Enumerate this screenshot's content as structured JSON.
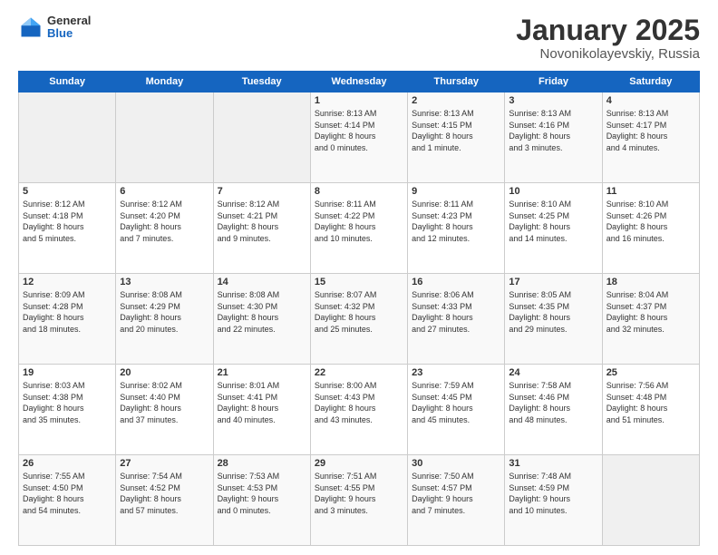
{
  "logo": {
    "general": "General",
    "blue": "Blue"
  },
  "header": {
    "title": "January 2025",
    "location": "Novonikolayevskiy, Russia"
  },
  "days_of_week": [
    "Sunday",
    "Monday",
    "Tuesday",
    "Wednesday",
    "Thursday",
    "Friday",
    "Saturday"
  ],
  "weeks": [
    [
      {
        "day": "",
        "info": ""
      },
      {
        "day": "",
        "info": ""
      },
      {
        "day": "",
        "info": ""
      },
      {
        "day": "1",
        "info": "Sunrise: 8:13 AM\nSunset: 4:14 PM\nDaylight: 8 hours\nand 0 minutes."
      },
      {
        "day": "2",
        "info": "Sunrise: 8:13 AM\nSunset: 4:15 PM\nDaylight: 8 hours\nand 1 minute."
      },
      {
        "day": "3",
        "info": "Sunrise: 8:13 AM\nSunset: 4:16 PM\nDaylight: 8 hours\nand 3 minutes."
      },
      {
        "day": "4",
        "info": "Sunrise: 8:13 AM\nSunset: 4:17 PM\nDaylight: 8 hours\nand 4 minutes."
      }
    ],
    [
      {
        "day": "5",
        "info": "Sunrise: 8:12 AM\nSunset: 4:18 PM\nDaylight: 8 hours\nand 5 minutes."
      },
      {
        "day": "6",
        "info": "Sunrise: 8:12 AM\nSunset: 4:20 PM\nDaylight: 8 hours\nand 7 minutes."
      },
      {
        "day": "7",
        "info": "Sunrise: 8:12 AM\nSunset: 4:21 PM\nDaylight: 8 hours\nand 9 minutes."
      },
      {
        "day": "8",
        "info": "Sunrise: 8:11 AM\nSunset: 4:22 PM\nDaylight: 8 hours\nand 10 minutes."
      },
      {
        "day": "9",
        "info": "Sunrise: 8:11 AM\nSunset: 4:23 PM\nDaylight: 8 hours\nand 12 minutes."
      },
      {
        "day": "10",
        "info": "Sunrise: 8:10 AM\nSunset: 4:25 PM\nDaylight: 8 hours\nand 14 minutes."
      },
      {
        "day": "11",
        "info": "Sunrise: 8:10 AM\nSunset: 4:26 PM\nDaylight: 8 hours\nand 16 minutes."
      }
    ],
    [
      {
        "day": "12",
        "info": "Sunrise: 8:09 AM\nSunset: 4:28 PM\nDaylight: 8 hours\nand 18 minutes."
      },
      {
        "day": "13",
        "info": "Sunrise: 8:08 AM\nSunset: 4:29 PM\nDaylight: 8 hours\nand 20 minutes."
      },
      {
        "day": "14",
        "info": "Sunrise: 8:08 AM\nSunset: 4:30 PM\nDaylight: 8 hours\nand 22 minutes."
      },
      {
        "day": "15",
        "info": "Sunrise: 8:07 AM\nSunset: 4:32 PM\nDaylight: 8 hours\nand 25 minutes."
      },
      {
        "day": "16",
        "info": "Sunrise: 8:06 AM\nSunset: 4:33 PM\nDaylight: 8 hours\nand 27 minutes."
      },
      {
        "day": "17",
        "info": "Sunrise: 8:05 AM\nSunset: 4:35 PM\nDaylight: 8 hours\nand 29 minutes."
      },
      {
        "day": "18",
        "info": "Sunrise: 8:04 AM\nSunset: 4:37 PM\nDaylight: 8 hours\nand 32 minutes."
      }
    ],
    [
      {
        "day": "19",
        "info": "Sunrise: 8:03 AM\nSunset: 4:38 PM\nDaylight: 8 hours\nand 35 minutes."
      },
      {
        "day": "20",
        "info": "Sunrise: 8:02 AM\nSunset: 4:40 PM\nDaylight: 8 hours\nand 37 minutes."
      },
      {
        "day": "21",
        "info": "Sunrise: 8:01 AM\nSunset: 4:41 PM\nDaylight: 8 hours\nand 40 minutes."
      },
      {
        "day": "22",
        "info": "Sunrise: 8:00 AM\nSunset: 4:43 PM\nDaylight: 8 hours\nand 43 minutes."
      },
      {
        "day": "23",
        "info": "Sunrise: 7:59 AM\nSunset: 4:45 PM\nDaylight: 8 hours\nand 45 minutes."
      },
      {
        "day": "24",
        "info": "Sunrise: 7:58 AM\nSunset: 4:46 PM\nDaylight: 8 hours\nand 48 minutes."
      },
      {
        "day": "25",
        "info": "Sunrise: 7:56 AM\nSunset: 4:48 PM\nDaylight: 8 hours\nand 51 minutes."
      }
    ],
    [
      {
        "day": "26",
        "info": "Sunrise: 7:55 AM\nSunset: 4:50 PM\nDaylight: 8 hours\nand 54 minutes."
      },
      {
        "day": "27",
        "info": "Sunrise: 7:54 AM\nSunset: 4:52 PM\nDaylight: 8 hours\nand 57 minutes."
      },
      {
        "day": "28",
        "info": "Sunrise: 7:53 AM\nSunset: 4:53 PM\nDaylight: 9 hours\nand 0 minutes."
      },
      {
        "day": "29",
        "info": "Sunrise: 7:51 AM\nSunset: 4:55 PM\nDaylight: 9 hours\nand 3 minutes."
      },
      {
        "day": "30",
        "info": "Sunrise: 7:50 AM\nSunset: 4:57 PM\nDaylight: 9 hours\nand 7 minutes."
      },
      {
        "day": "31",
        "info": "Sunrise: 7:48 AM\nSunset: 4:59 PM\nDaylight: 9 hours\nand 10 minutes."
      },
      {
        "day": "",
        "info": ""
      }
    ]
  ]
}
